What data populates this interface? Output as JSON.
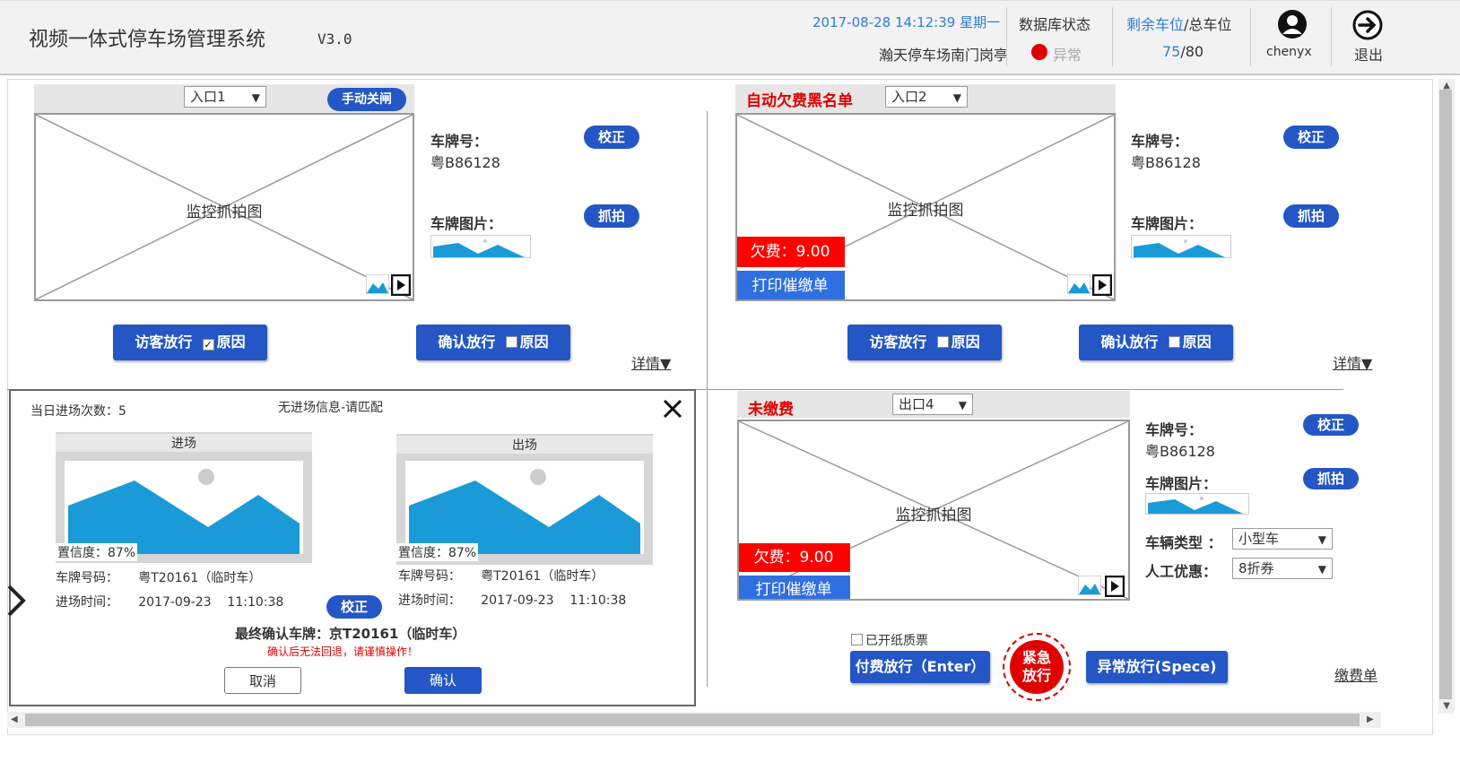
{
  "header": {
    "title": "视频一体式停车场管理系统",
    "version": "V3.0",
    "datetime": "2017-08-28 14:12:39 星期一",
    "station": "瀚天停车场南门岗亭",
    "db_status_label": "数据库状态",
    "db_status_value": "异常",
    "spaces_label_a": "剩余车位",
    "spaces_label_b": "/总车位",
    "spaces_remaining": "75",
    "spaces_total": "/80",
    "username": "chenyx",
    "logout_label": "退出",
    "colors": {
      "accent_blue": "#2457c5",
      "alert_red": "#ff0000",
      "link_blue": "#2f7dd6"
    }
  },
  "lane1": {
    "select_value": "入口1",
    "manual_close": "手动关闸",
    "cam_label": "监控抓拍图",
    "plate_label": "车牌号：",
    "plate_value": "粤B86128",
    "plate_img_label": "车牌图片：",
    "correct": "校正",
    "capture": "抓拍",
    "visitor_btn": "访客放行",
    "visitor_reason": "原因",
    "confirm_btn": "确认放行",
    "confirm_reason": "原因",
    "details": "详情▼"
  },
  "lane2": {
    "title": "自动欠费黑名单",
    "select_value": "入口2",
    "cam_label": "监控抓拍图",
    "arrears": "欠费：9.00",
    "print": "打印催缴单",
    "plate_label": "车牌号：",
    "plate_value": "粤B86128",
    "plate_img_label": "车牌图片：",
    "correct": "校正",
    "capture": "抓拍",
    "visitor_btn": "访客放行",
    "visitor_reason": "原因",
    "confirm_btn": "确认放行",
    "confirm_reason": "原因",
    "details": "详情▼"
  },
  "dialog": {
    "entries_today": "当日进场次数：5",
    "title": "无进场信息-请匹配",
    "in_label": "进场",
    "out_label": "出场",
    "in_confidence": "置信度：87%",
    "out_confidence": "置信度：87%",
    "in_plate": "车牌号码：     粤T20161（临时车）",
    "out_plate": "车牌号码：     粤T20161（临时车）",
    "in_time": "进场时间：     2017-09-23    11:10:38",
    "out_time": "进场时间：     2017-09-23    11:10:38",
    "correct": "校正",
    "final_plate": "最终确认车牌：京T20161（临时车）",
    "warning": "确认后无法回退，请谨慎操作！",
    "cancel": "取消",
    "confirm": "确认"
  },
  "lane4": {
    "title": "未缴费",
    "select_value": "出口4",
    "cam_label": "监控抓拍图",
    "arrears": "欠费：9.00",
    "print": "打印催缴单",
    "plate_label": "车牌号：",
    "plate_value": "粤B86128",
    "plate_img_label": "车牌图片：",
    "correct": "校正",
    "capture": "抓拍",
    "vehicle_type_label": "车辆类型 ：",
    "vehicle_type_value": "小型车",
    "discount_label": "人工优惠：",
    "discount_value": "8折券",
    "paper_ticket": "已开纸质票",
    "pay_btn": "付费放行（Enter）",
    "emergency": "紧急放行",
    "abnormal_btn": "异常放行(Spece)",
    "pay_record": "缴费单"
  }
}
